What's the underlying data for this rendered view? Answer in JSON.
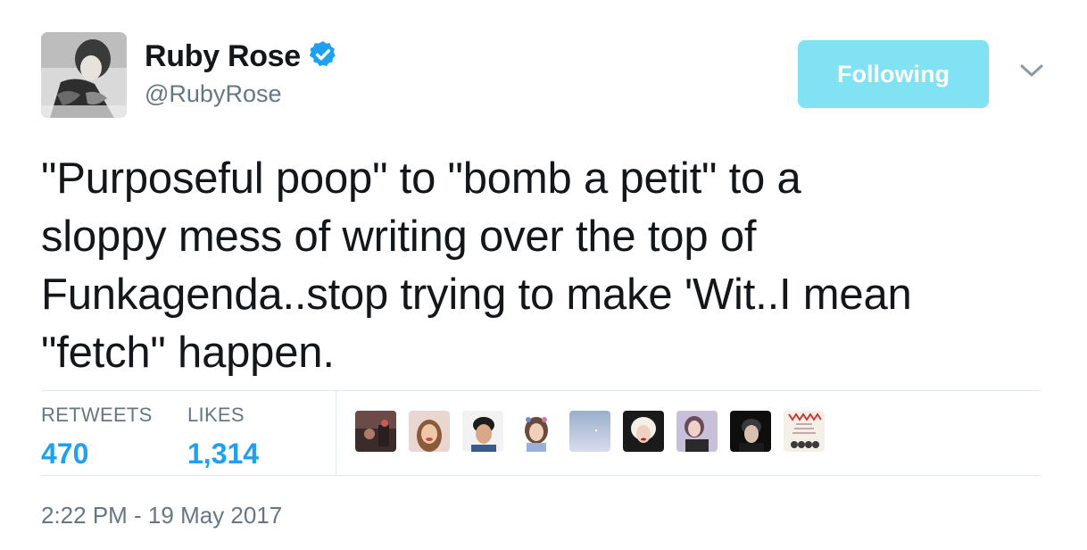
{
  "author": {
    "name": "Ruby Rose",
    "handle": "@RubyRose",
    "verified": true
  },
  "follow_button": {
    "label": "Following",
    "color": "#81e2f3"
  },
  "tweet": {
    "lines": [
      "\"Purposeful poop\" to \"bomb a petit\" to a",
      "sloppy mess of writing over the top of",
      "Funkagenda..stop trying to make 'Wit..I mean",
      "\"fetch\" happen."
    ]
  },
  "stats": {
    "retweets_label": "RETWEETS",
    "retweets_value": "470",
    "likes_label": "LIKES",
    "likes_value": "1,314"
  },
  "likers": [
    {
      "icon": "liker-avatar-1"
    },
    {
      "icon": "liker-avatar-2"
    },
    {
      "icon": "liker-avatar-3"
    },
    {
      "icon": "liker-avatar-4"
    },
    {
      "icon": "liker-avatar-5"
    },
    {
      "icon": "liker-avatar-6"
    },
    {
      "icon": "liker-avatar-7"
    },
    {
      "icon": "liker-avatar-8"
    },
    {
      "icon": "liker-avatar-9"
    }
  ],
  "timestamp": "2:22 PM - 19 May 2017",
  "colors": {
    "accent": "#1da1f2",
    "muted": "#657786",
    "text": "#14171a",
    "divider": "#e1e8ed"
  }
}
